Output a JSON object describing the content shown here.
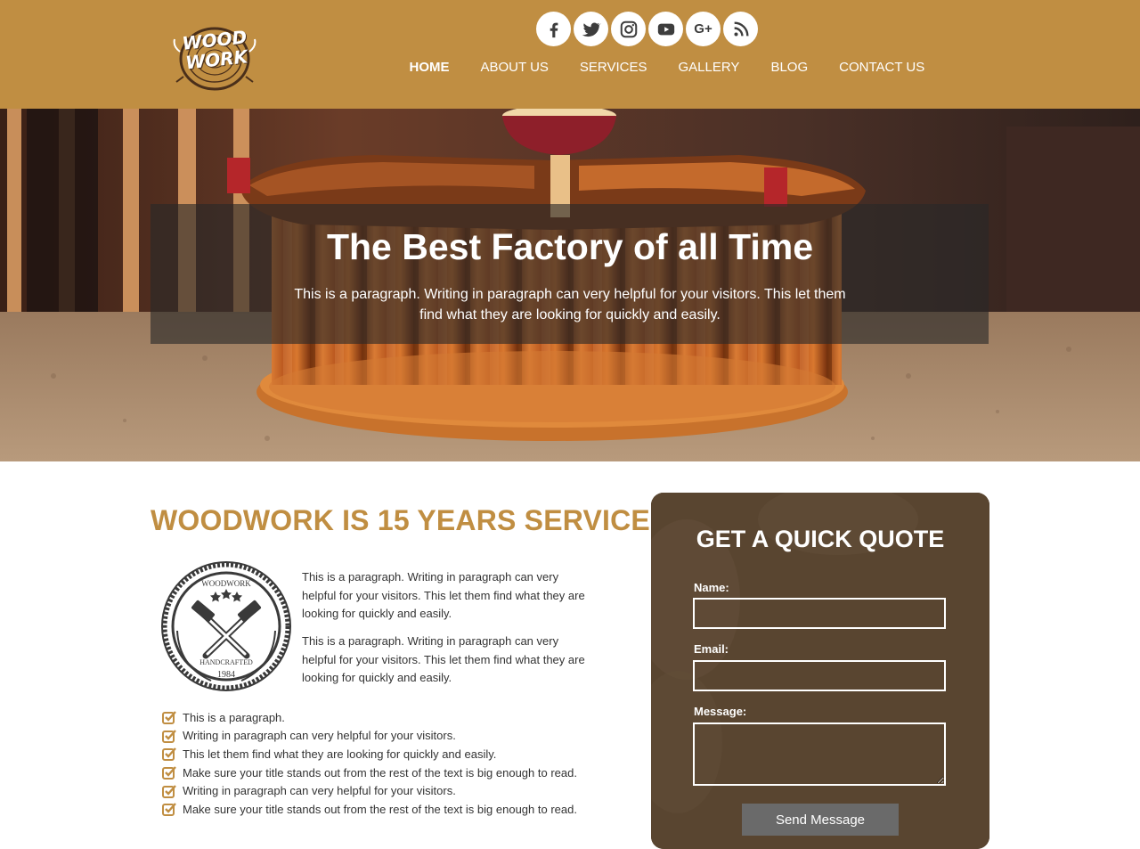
{
  "brand": {
    "logo_text_1": "WOOD",
    "logo_text_2": "WORK",
    "accent_color": "#c08e42",
    "dark_color": "#5a4631"
  },
  "social": [
    {
      "icon": "facebook-icon"
    },
    {
      "icon": "twitter-icon"
    },
    {
      "icon": "instagram-icon"
    },
    {
      "icon": "youtube-icon"
    },
    {
      "icon": "google-plus-icon",
      "glyph": "G+"
    },
    {
      "icon": "rss-icon"
    }
  ],
  "nav": {
    "items": [
      "HOME",
      "ABOUT US",
      "SERVICES",
      "GALLERY",
      "BLOG",
      "CONTACT US"
    ],
    "active": "HOME"
  },
  "hero": {
    "title": "The Best Factory of all Time",
    "text": "This is a paragraph. Writing in paragraph can very helpful for your visitors. This let them find what they are looking for quickly and easily."
  },
  "about": {
    "title": "WOODWORK IS 15 YEARS SERVICE",
    "badge": {
      "top": "WOODWORK",
      "bottom": "HANDCRAFTED",
      "year": "1984"
    },
    "paragraphs": [
      "This is a paragraph. Writing in paragraph can very helpful for your visitors. This let them find what they are looking for quickly and easily.",
      "This is a paragraph. Writing in paragraph can very helpful for your visitors. This let them find what they are looking for quickly and easily."
    ],
    "checklist": [
      "This is a paragraph.",
      "Writing in paragraph can very helpful for your visitors.",
      "This let them find what they are looking for quickly and easily.",
      "Make sure your title stands out from the rest of the text is big enough to read.",
      "Writing in paragraph can very helpful for your visitors.",
      "Make sure your title stands out from the rest of the text is big enough to read."
    ]
  },
  "quote": {
    "title": "GET A QUICK QUOTE",
    "name_label": "Name:",
    "email_label": "Email:",
    "message_label": "Message:",
    "name_value": "",
    "email_value": "",
    "message_value": "",
    "send_label": "Send Message"
  }
}
